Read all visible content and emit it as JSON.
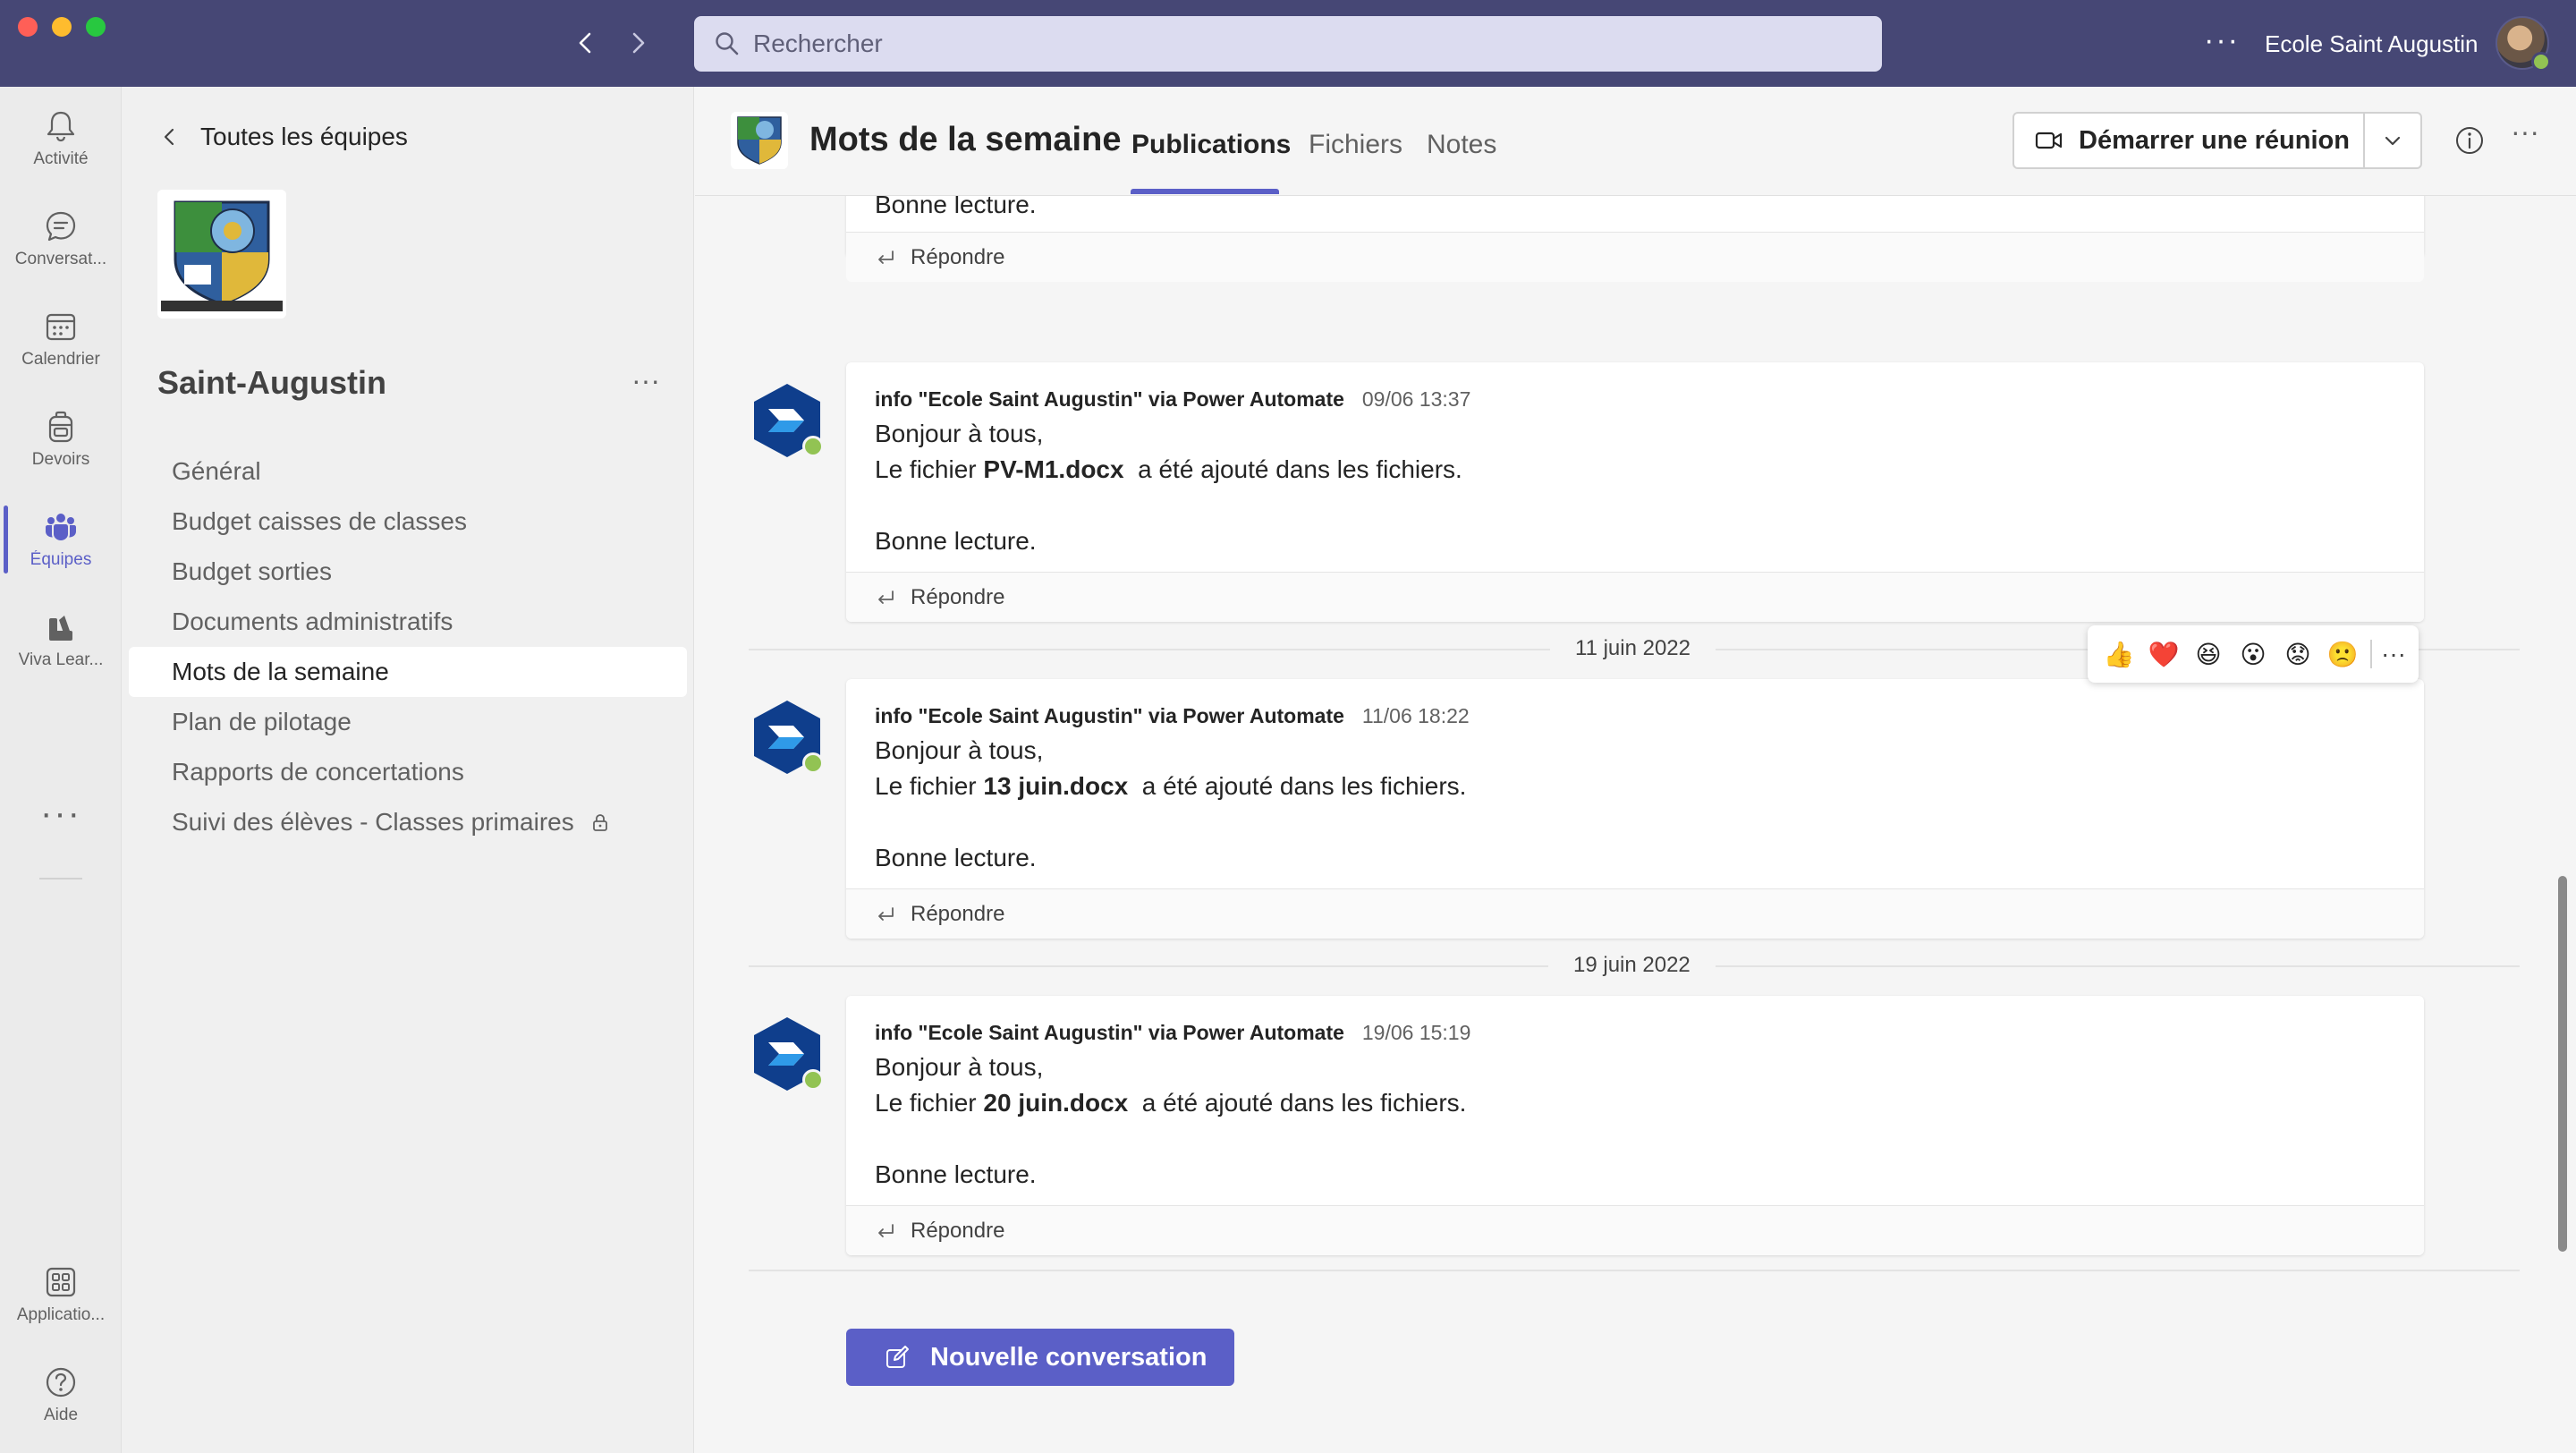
{
  "titlebar": {
    "search_placeholder": "Rechercher",
    "more": "···",
    "user_name": "Ecole Saint Augustin"
  },
  "rail": {
    "items": [
      {
        "label": "Activité",
        "icon": "bell-icon"
      },
      {
        "label": "Conversat...",
        "icon": "chat-icon"
      },
      {
        "label": "Calendrier",
        "icon": "calendar-icon"
      },
      {
        "label": "Devoirs",
        "icon": "backpack-icon"
      },
      {
        "label": "Équipes",
        "icon": "teams-icon",
        "active": true
      },
      {
        "label": "Viva Lear...",
        "icon": "books-icon"
      }
    ],
    "more": "···",
    "bottom": [
      {
        "label": "Applicatio...",
        "icon": "apps-icon"
      },
      {
        "label": "Aide",
        "icon": "help-icon"
      }
    ]
  },
  "teampanel": {
    "back_label": "Toutes les équipes",
    "team_name": "Saint-Augustin",
    "more": "···",
    "channels": [
      {
        "label": "Général"
      },
      {
        "label": "Budget caisses de classes"
      },
      {
        "label": "Budget sorties"
      },
      {
        "label": "Documents administratifs"
      },
      {
        "label": "Mots de la semaine",
        "active": true
      },
      {
        "label": "Plan de pilotage"
      },
      {
        "label": "Rapports de concertations"
      },
      {
        "label": "Suivi des élèves - Classes primaires",
        "locked": true
      }
    ]
  },
  "header": {
    "channel_title": "Mots de la semaine",
    "tabs": [
      {
        "label": "Publications",
        "active": true
      },
      {
        "label": "Fichiers"
      },
      {
        "label": "Notes"
      }
    ],
    "meet_label": "Démarrer une réunion",
    "more": "···"
  },
  "feed": {
    "partial_message": {
      "closing": "Bonne lecture.",
      "reply": "Répondre"
    },
    "messages": [
      {
        "author": "info \"Ecole Saint Augustin\" via Power Automate",
        "time": "09/06 13:37",
        "greeting": "Bonjour à tous,",
        "prefix": "Le fichier ",
        "file": "PV-M1.docx",
        "suffix": "  a été ajouté dans les fichiers.",
        "closing": "Bonne lecture.",
        "reply": "Répondre"
      },
      {
        "author": "info \"Ecole Saint Augustin\" via Power Automate",
        "time": "11/06 18:22",
        "greeting": "Bonjour à tous,",
        "prefix": "Le fichier ",
        "file": "13 juin.docx",
        "suffix": "  a été ajouté dans les fichiers.",
        "closing": "Bonne lecture.",
        "reply": "Répondre"
      },
      {
        "author": "info \"Ecole Saint Augustin\" via Power Automate",
        "time": "19/06 15:19",
        "greeting": "Bonjour à tous,",
        "prefix": "Le fichier ",
        "file": "20 juin.docx",
        "suffix": "  a été ajouté dans les fichiers.",
        "closing": "Bonne lecture.",
        "reply": "Répondre"
      }
    ],
    "date_separators": [
      "11 juin 2022",
      "19 juin 2022"
    ],
    "reactions": [
      "👍",
      "❤️",
      "😆",
      "😮",
      "😟",
      "🙁"
    ],
    "reactions_more": "···",
    "new_conversation": "Nouvelle conversation"
  },
  "colors": {
    "titlebar": "#464775",
    "accent": "#5b5fc7",
    "presence": "#92c353"
  }
}
